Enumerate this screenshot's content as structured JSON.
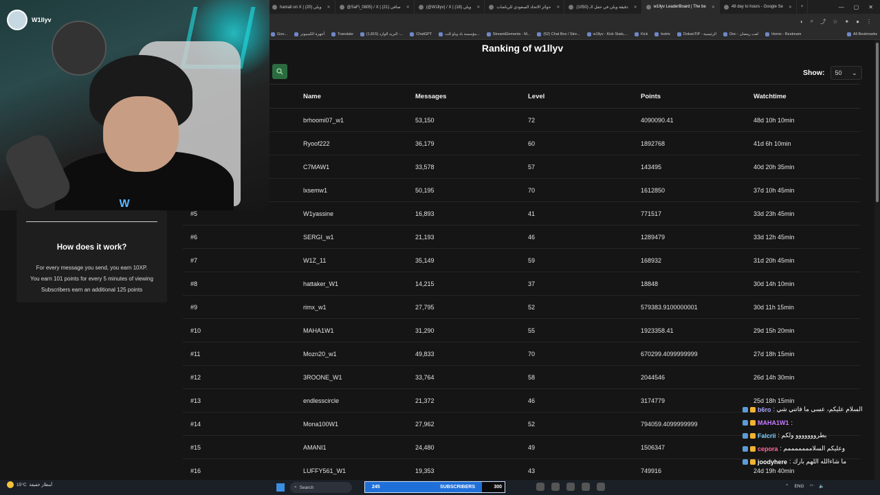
{
  "browser": {
    "tabs": [
      {
        "label": "hamali on X | ويلي (20)",
        "active": false
      },
      {
        "label": "@SaFi_0805) / X | صافي (21)",
        "active": false
      },
      {
        "label": "(@W1llyv) / X | ويلي (18)",
        "active": false
      },
      {
        "label": "جوائز الاتحاد السعودي للرياضات",
        "active": false
      },
      {
        "label": "(1050) دقيقة ويلي في حفل الـ",
        "active": false
      },
      {
        "label": "w1llyv LeaderBoard | The be",
        "active": true
      },
      {
        "label": "48 day to hours - Google Se",
        "active": false
      }
    ],
    "new_tab": "+",
    "bookmarks": [
      "Goo...",
      "أجهزة الكمبيوتر",
      "Translate",
      "البريد الوارد (1,815) -...",
      "ChatGPT",
      "مؤسسة باد وباو للت...",
      "StreamElements - M...",
      "(52) Chat Box / Stre...",
      "w1llyv - Kick Stats,...",
      "Kick",
      "botrix",
      "DokanTIP - الرئيسية",
      "Doc - لعب رمضان",
      "Home - Restream"
    ],
    "all_bookmarks": "All Bookmarks"
  },
  "stream": {
    "channel_name": "W1llyv",
    "logo_mark": "W"
  },
  "info_card": {
    "title": "How does it work?",
    "lines": [
      "For every message you send, you earn 10XP.",
      "You earn 101 points for every 5 minutes of viewing",
      "Subscribers earn an additional 125 points"
    ]
  },
  "page": {
    "title": "Ranking of w1llyv",
    "show_label": "Show:",
    "show_value": "50"
  },
  "table": {
    "headers": {
      "rank": "",
      "name": "Name",
      "messages": "Messages",
      "level": "Level",
      "points": "Points",
      "watchtime": "Watchtime"
    },
    "rows": [
      {
        "rank": "",
        "name": "brhoomi07_w1",
        "messages": "53,150",
        "level": "72",
        "points": "4090090.41",
        "watchtime": "48d 10h 10min"
      },
      {
        "rank": "",
        "name": "Ryoof222",
        "messages": "36,179",
        "level": "60",
        "points": "1892768",
        "watchtime": "41d 6h 10min"
      },
      {
        "rank": "",
        "name": "C7MAW1",
        "messages": "33,578",
        "level": "57",
        "points": "143495",
        "watchtime": "40d 20h 35min"
      },
      {
        "rank": "",
        "name": "lxsemw1",
        "messages": "50,195",
        "level": "70",
        "points": "1612850",
        "watchtime": "37d 10h 45min"
      },
      {
        "rank": "#5",
        "name": "W1yassine",
        "messages": "16,893",
        "level": "41",
        "points": "771517",
        "watchtime": "33d 23h 45min"
      },
      {
        "rank": "#6",
        "name": "SERGI_w1",
        "messages": "21,193",
        "level": "46",
        "points": "1289479",
        "watchtime": "33d 12h 45min"
      },
      {
        "rank": "#7",
        "name": "W1Z_11",
        "messages": "35,149",
        "level": "59",
        "points": "168932",
        "watchtime": "31d 20h 45min"
      },
      {
        "rank": "#8",
        "name": "hattaker_W1",
        "messages": "14,215",
        "level": "37",
        "points": "18848",
        "watchtime": "30d 14h 10min"
      },
      {
        "rank": "#9",
        "name": "rimx_w1",
        "messages": "27,795",
        "level": "52",
        "points": "579383.9100000001",
        "watchtime": "30d 11h 15min"
      },
      {
        "rank": "#10",
        "name": "MAHA1W1",
        "messages": "31,290",
        "level": "55",
        "points": "1923358.41",
        "watchtime": "29d 15h 20min"
      },
      {
        "rank": "#11",
        "name": "Mozn20_w1",
        "messages": "49,833",
        "level": "70",
        "points": "670299.4099999999",
        "watchtime": "27d 18h 15min"
      },
      {
        "rank": "#12",
        "name": "3ROONE_W1",
        "messages": "33,764",
        "level": "58",
        "points": "2044546",
        "watchtime": "26d 14h 30min"
      },
      {
        "rank": "#13",
        "name": "endlesscircle",
        "messages": "21,372",
        "level": "46",
        "points": "3174779",
        "watchtime": "25d 18h 15min"
      },
      {
        "rank": "#14",
        "name": "Mona100W1",
        "messages": "27,962",
        "level": "52",
        "points": "794059.4099999999",
        "watchtime": ""
      },
      {
        "rank": "#15",
        "name": "AMANI1",
        "messages": "24,480",
        "level": "49",
        "points": "1506347",
        "watchtime": ""
      },
      {
        "rank": "#16",
        "name": "LUFFY561_W1",
        "messages": "19,353",
        "level": "43",
        "points": "749916",
        "watchtime": "24d 19h 40min"
      }
    ]
  },
  "chat": [
    {
      "user": "b6ro",
      "text": ": السلام عليكم، عسى ما فاتني شي",
      "color": "#a9a4ff"
    },
    {
      "user": "MAHA1W1",
      "text": ":",
      "color": "#c77dff"
    },
    {
      "user": "Falcrii",
      "text": ": بطرووووووو ولكم",
      "color": "#7fd1ff"
    },
    {
      "user": "cepora",
      "text": ": وعليكم السلامممممممم",
      "color": "#ff6b9a"
    },
    {
      "user": "joodyhere",
      "text": ": ما شاءالله اللهم بارك",
      "color": "#ffffff"
    }
  ],
  "taskbar": {
    "weather_temp": "15°C",
    "weather_text": "أمطار خفيفة",
    "search_placeholder": "Search",
    "subs_count": "245",
    "subs_label": "SUBSCRIBERS",
    "subs_goal": "300",
    "lang": "ENG"
  },
  "colors": {
    "accent_green": "#2b6b3f",
    "sub_bar": "#1f6fd8",
    "neon": "#24e0e6"
  }
}
